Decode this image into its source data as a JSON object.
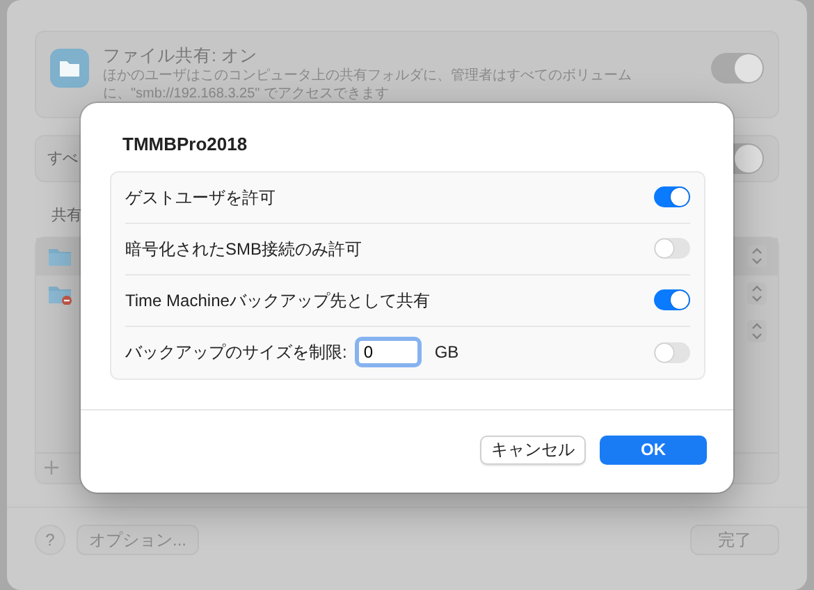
{
  "background": {
    "file_sharing": {
      "title": "ファイル共有: オン",
      "description": "ほかのユーザはこのコンピュータ上の共有フォルダに、管理者はすべてのボリュームに、\"smb://192.168.3.25\" でアクセスできます",
      "on": true
    },
    "row_2": {
      "label": "すべ",
      "on": true
    },
    "section_label": "共有",
    "shared_folders": [
      {
        "kind": "folder"
      },
      {
        "kind": "restricted-folder"
      }
    ],
    "footer": {
      "help": "?",
      "options": "オプション...",
      "done": "完了"
    }
  },
  "dialog": {
    "title": "TMMBPro2018",
    "options": [
      {
        "kind": "toggle",
        "label": "ゲストユーザを許可",
        "on": true
      },
      {
        "kind": "toggle",
        "label": "暗号化されたSMB接続のみ許可",
        "on": false
      },
      {
        "kind": "toggle",
        "label": "Time Machineバックアップ先として共有",
        "on": true
      },
      {
        "kind": "size-limit",
        "label": "バックアップのサイズを制限:",
        "value": "0",
        "unit": "GB",
        "on": false
      }
    ],
    "buttons": [
      {
        "kind": "secondary",
        "label": "キャンセル"
      },
      {
        "kind": "primary",
        "label": "OK"
      }
    ]
  }
}
